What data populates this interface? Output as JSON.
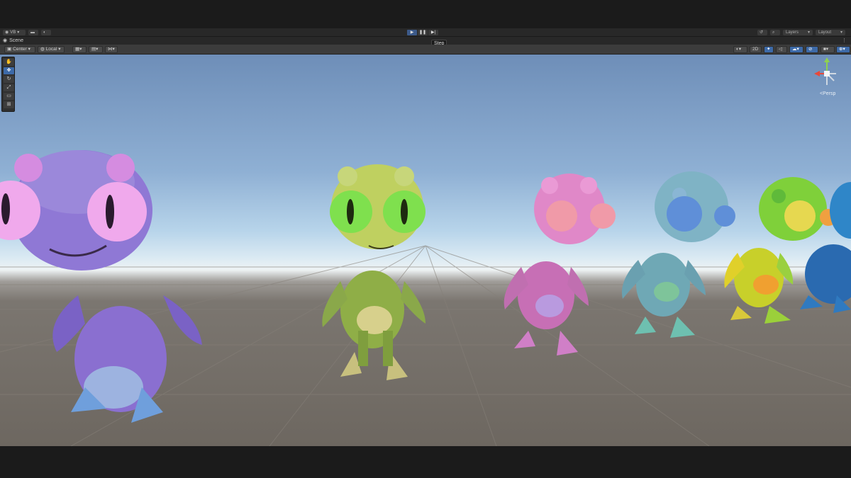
{
  "toolbar": {
    "account_label": "VB",
    "cloud_icon": "cloud-icon",
    "play_icon": "play-icon",
    "pause_icon": "pause-icon",
    "step_icon": "step-icon",
    "history_icon": "history-icon",
    "search_icon": "search-icon",
    "layers_label": "Layers",
    "layout_label": "Layout"
  },
  "scene_tab": {
    "label": "Scene"
  },
  "tooltip": {
    "text": "Step"
  },
  "scene_toolbar": {
    "pivot_label": "Center",
    "space_label": "Local",
    "mode_2d_label": "2D"
  },
  "view": {
    "projection_label": "<Persp"
  },
  "tools": [
    "hand-tool",
    "move-tool",
    "rotate-tool",
    "scale-tool",
    "rect-tool",
    "transform-tool"
  ],
  "colors": {
    "accent": "#3d6aa8",
    "sky_top": "#6e8eb8",
    "horizon": "#eef3f4",
    "ground": "#6d6760"
  },
  "scene_objects": [
    {
      "name": "alien-purple",
      "color": "#8a6fd0"
    },
    {
      "name": "alien-green",
      "color": "#9fbf50"
    },
    {
      "name": "alien-pink",
      "color": "#d77bc9"
    },
    {
      "name": "alien-teal",
      "color": "#6fa8b5"
    },
    {
      "name": "alien-rainbow",
      "color": "#7fd03a"
    },
    {
      "name": "alien-blue",
      "color": "#2a6ab0"
    }
  ]
}
